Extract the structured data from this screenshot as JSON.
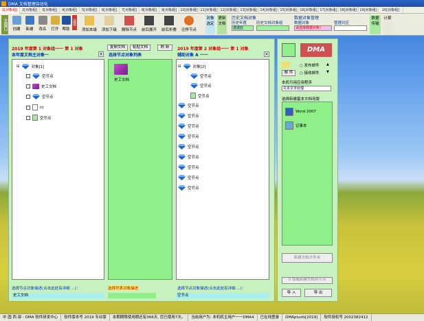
{
  "window": {
    "title": "DMA 文档管理自动化"
  },
  "tabs": [
    "1[对象组]",
    "2[对象组]",
    "3[对象组]",
    "4[对象组]",
    "5[对象组]",
    "6[对象组]",
    "7[对象组]",
    "8[对象组]",
    "9[对象组]",
    "10[对象组]",
    "11[对象组]",
    "12[对象组]",
    "13[对象组]",
    "14[对象组]",
    "15[对象组]",
    "16[对象组]",
    "17[对象组]",
    "18[对象组]",
    "19[对象组]",
    "20[对象组]"
  ],
  "toolbar": {
    "left_label": "主窗口",
    "buttons": [
      "创建",
      "新建",
      "改名",
      "打开",
      "帮助"
    ],
    "red_label": "选项",
    "buttons2": [
      "添加本级",
      "添加下级",
      "删除节点",
      "前后展开",
      "前后折叠",
      "迁移节点"
    ],
    "obj_buttons": [
      "对象选定",
      "更新文档"
    ],
    "history_title": "历史文档对象",
    "history_year_label": "历史年度",
    "history_year_value": "选选应",
    "history_doc_label": "历史文档对象组",
    "history_doc_value": "",
    "data_title": "数据对象管理",
    "data_obj_label": "数据对象",
    "data_obj_value": "请选择数据对象！",
    "manage_label": "管理对应",
    "manage_value": "",
    "right_buttons": [
      "数据传输",
      "计算"
    ]
  },
  "panel1": {
    "header": "2019 年度第 1 对象组一一 第 1 对象",
    "subheader": "本年度文档主对象一",
    "tree": [
      "对象[1]",
      "空节点",
      "史工文档",
      "空节点",
      "cc",
      "空节点"
    ]
  },
  "panel2": {
    "header_buttons": [
      "复制文档",
      "粘贴文档",
      "刷 新"
    ],
    "subheader": "选择节点对象列表",
    "items": [
      "史工文档"
    ]
  },
  "panel3": {
    "header": "2019 年度第 2 对象组一一 第 1 对象",
    "subheader": "辅助对象 A 一一",
    "tree": [
      "对象[2]",
      "空节点",
      "空节点",
      "空节点",
      "空节点",
      "空节点",
      "空节点",
      "空节点",
      "空节点",
      "空节点",
      "空节点",
      "空节点",
      "空节点"
    ]
  },
  "bottom": {
    "desc1_label": "选择节点对象描述(点击此处有详细 ...)：",
    "desc1_value": "史工文档",
    "desc2_label": "选择列表对象描述",
    "desc2_value": "选择列表对象描述",
    "desc3_label": "选择节点对象描述(点击此处有详细 ...)：",
    "desc3_value": "空节点"
  },
  "right": {
    "logo": "DMA",
    "mail_label": "邮 件",
    "radio1": "发布邮件",
    "radio2": "接收邮件",
    "app_label": "本机可用应用程序",
    "app_value": "文本文字处理",
    "template_label": "选择新建基本文档母版",
    "templates": [
      "Word 2007",
      "记事本"
    ],
    "btn_createtext": "新建文档文件夹",
    "btn_addnode": "0 加载新建文档到节点",
    "btn_import": "导 入",
    "btn_export": "导 出"
  },
  "status": [
    "中 国 西 部 - DMA 软件研发中心",
    "软件版本号 2019 专业版",
    "本期期限使用期还有366天, 您已使用7次。",
    "当前用户为: 本机机主用户一一DMA4",
    "已在线登录",
    "DMAplusfs[2019]",
    "软件授权号 2002382412"
  ]
}
